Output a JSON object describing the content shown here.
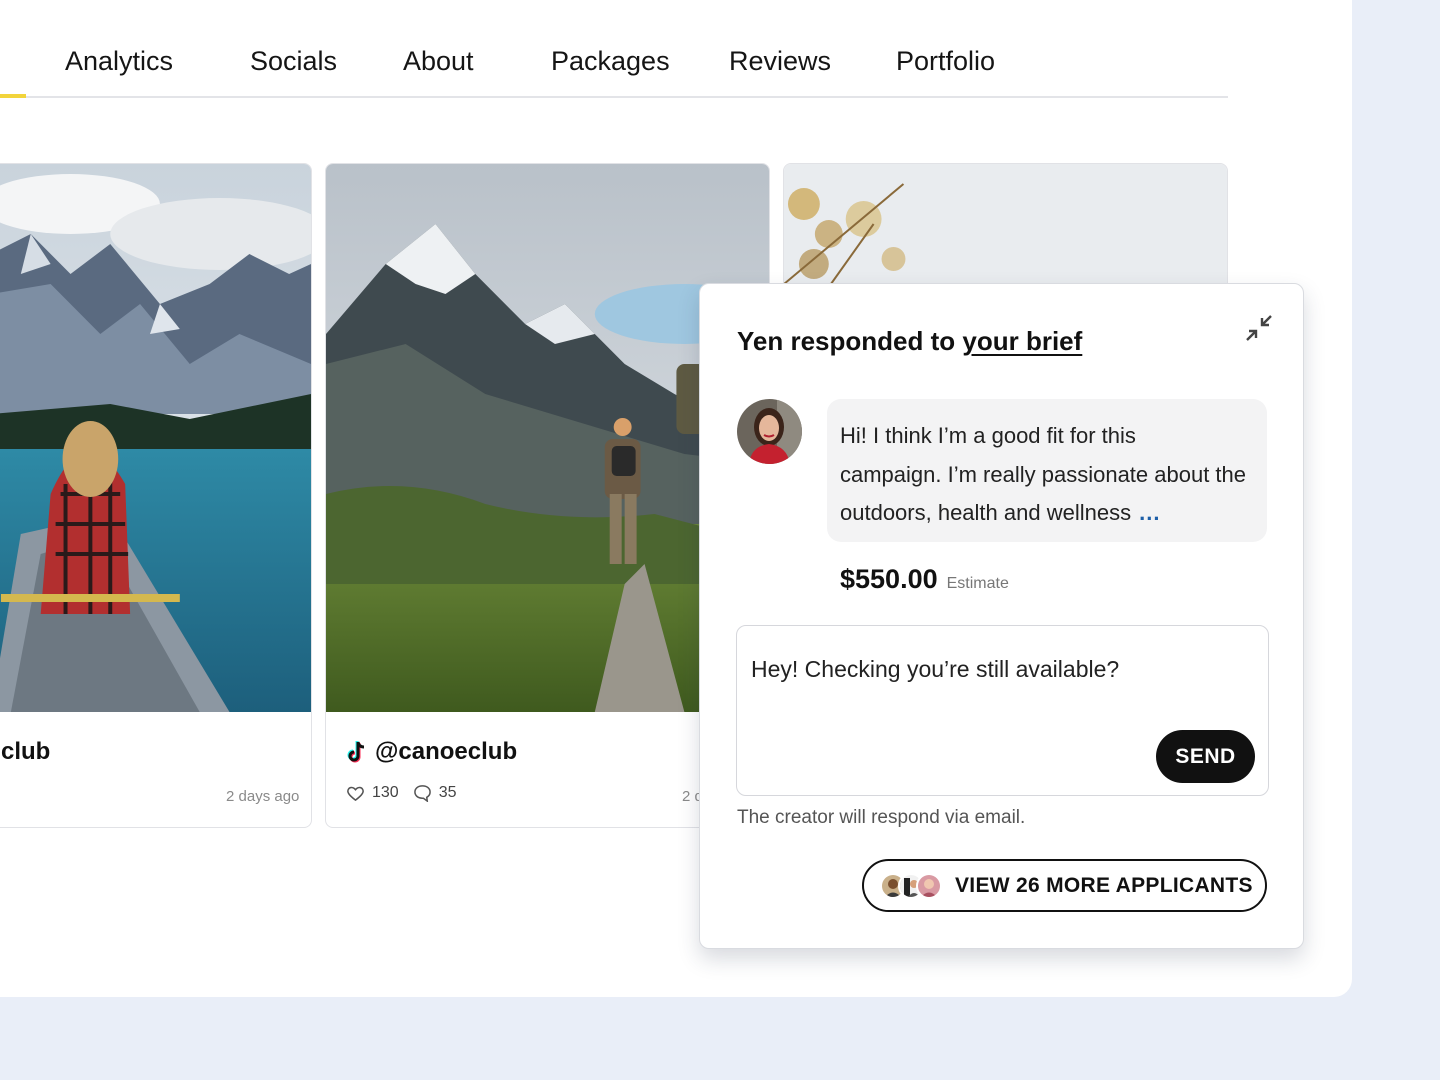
{
  "nav": {
    "tabs": [
      {
        "label": "Analytics"
      },
      {
        "label": "Socials"
      },
      {
        "label": "About"
      },
      {
        "label": "Packages"
      },
      {
        "label": "Reviews"
      },
      {
        "label": "Portfolio"
      }
    ],
    "accent_color": "#f2d43b"
  },
  "posts": [
    {
      "handle_visible": "club",
      "date": "2 days ago"
    },
    {
      "platform_icon": "tiktok-icon",
      "handle": "@canoeclub",
      "likes": "130",
      "comments": "35",
      "date_visible": "2 d"
    },
    {}
  ],
  "popup": {
    "title_prefix": "Yen responded to ",
    "title_link": "your brief",
    "message_lines": [
      "Hi! I think I’m a good fit for this",
      "campaign. I’m really passionate about the",
      "outdoors, health and wellness"
    ],
    "more_label": "...",
    "price": "$550.00",
    "price_label": "Estimate",
    "reply_value": "Hey! Checking you’re still available?",
    "send_label": "SEND",
    "note": "The creator will respond via email.",
    "applicants_label": "VIEW 26 MORE APPLICANTS"
  }
}
